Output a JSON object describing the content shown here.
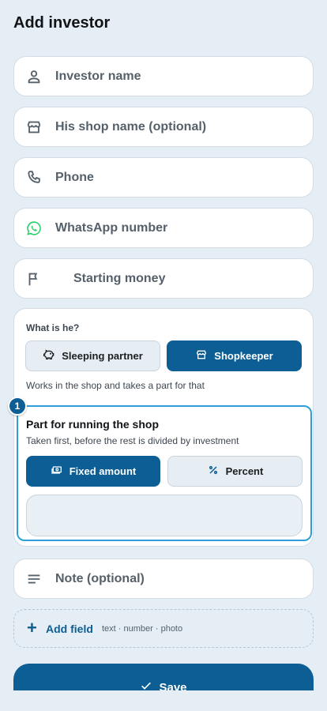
{
  "header": {
    "title": "Add investor"
  },
  "fields": {
    "investor_name": {
      "placeholder": "Investor name",
      "icon": "person-icon"
    },
    "shop_name": {
      "placeholder": "His shop name (optional)",
      "icon": "store-icon"
    },
    "phone": {
      "placeholder": "Phone",
      "icon": "phone-icon"
    },
    "whatsapp": {
      "placeholder": "WhatsApp number",
      "icon": "whatsapp-icon",
      "icon_color": "#25d366"
    },
    "starting_money": {
      "placeholder": "Starting money",
      "icon": "flag-icon"
    },
    "note": {
      "placeholder": "Note (optional)",
      "icon": "notes-icon"
    }
  },
  "role": {
    "question": "What is he?",
    "options": [
      {
        "label": "Sleeping partner",
        "icon": "piggy-bank-icon",
        "selected": false
      },
      {
        "label": "Shopkeeper",
        "icon": "store-icon",
        "selected": true
      }
    ],
    "hint": "Works in the shop and takes a part for that"
  },
  "shop_part": {
    "step_badge": "1",
    "title": "Part for running the shop",
    "description": "Taken first, before the rest is divided by investment",
    "options": [
      {
        "label": "Fixed amount",
        "icon": "cash-icon",
        "selected": true
      },
      {
        "label": "Percent",
        "icon": "percent-icon",
        "selected": false
      }
    ],
    "amount_value": ""
  },
  "add_field": {
    "label": "Add field",
    "hint": "text · number · photo"
  },
  "save": {
    "label": "Save",
    "icon": "check-icon"
  },
  "colors": {
    "primary": "#0c5e95",
    "background": "#e5eef5",
    "highlight_border": "#2f9fda",
    "whatsapp": "#25d366"
  }
}
